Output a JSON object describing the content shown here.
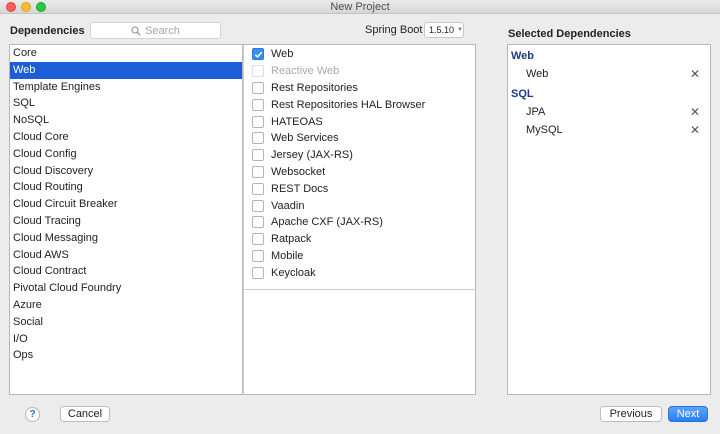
{
  "window": {
    "title": "New Project"
  },
  "dependencies_heading": "Dependencies",
  "search": {
    "placeholder": "Search"
  },
  "spring_boot": {
    "label": "Spring Boot",
    "version": "1.5.10"
  },
  "categories": [
    {
      "label": "Core",
      "selected": false
    },
    {
      "label": "Web",
      "selected": true
    },
    {
      "label": "Template Engines",
      "selected": false
    },
    {
      "label": "SQL",
      "selected": false
    },
    {
      "label": "NoSQL",
      "selected": false
    },
    {
      "label": "Cloud Core",
      "selected": false
    },
    {
      "label": "Cloud Config",
      "selected": false
    },
    {
      "label": "Cloud Discovery",
      "selected": false
    },
    {
      "label": "Cloud Routing",
      "selected": false
    },
    {
      "label": "Cloud Circuit Breaker",
      "selected": false
    },
    {
      "label": "Cloud Tracing",
      "selected": false
    },
    {
      "label": "Cloud Messaging",
      "selected": false
    },
    {
      "label": "Cloud AWS",
      "selected": false
    },
    {
      "label": "Cloud Contract",
      "selected": false
    },
    {
      "label": "Pivotal Cloud Foundry",
      "selected": false
    },
    {
      "label": "Azure",
      "selected": false
    },
    {
      "label": "Social",
      "selected": false
    },
    {
      "label": "I/O",
      "selected": false
    },
    {
      "label": "Ops",
      "selected": false
    }
  ],
  "dependencies": [
    {
      "label": "Web",
      "checked": true,
      "disabled": false
    },
    {
      "label": "Reactive Web",
      "checked": false,
      "disabled": true
    },
    {
      "label": "Rest Repositories",
      "checked": false,
      "disabled": false
    },
    {
      "label": "Rest Repositories HAL Browser",
      "checked": false,
      "disabled": false
    },
    {
      "label": "HATEOAS",
      "checked": false,
      "disabled": false
    },
    {
      "label": "Web Services",
      "checked": false,
      "disabled": false
    },
    {
      "label": "Jersey (JAX-RS)",
      "checked": false,
      "disabled": false
    },
    {
      "label": "Websocket",
      "checked": false,
      "disabled": false
    },
    {
      "label": "REST Docs",
      "checked": false,
      "disabled": false
    },
    {
      "label": "Vaadin",
      "checked": false,
      "disabled": false
    },
    {
      "label": "Apache CXF (JAX-RS)",
      "checked": false,
      "disabled": false
    },
    {
      "label": "Ratpack",
      "checked": false,
      "disabled": false
    },
    {
      "label": "Mobile",
      "checked": false,
      "disabled": false
    },
    {
      "label": "Keycloak",
      "checked": false,
      "disabled": false
    }
  ],
  "selected_heading": "Selected Dependencies",
  "selected_groups": [
    {
      "title": "Web",
      "items": [
        "Web"
      ]
    },
    {
      "title": "SQL",
      "items": [
        "JPA",
        "MySQL"
      ]
    }
  ],
  "buttons": {
    "help": "?",
    "cancel": "Cancel",
    "previous": "Previous",
    "next": "Next"
  },
  "icons": {
    "search": "search-icon",
    "remove": "close-icon",
    "check": "checkmark-icon",
    "dropdown": "chevron-down-icon"
  },
  "colors": {
    "selection": "#1d5ed8",
    "group_title": "#1a3b86",
    "primary_button": "#2a7ff3"
  }
}
